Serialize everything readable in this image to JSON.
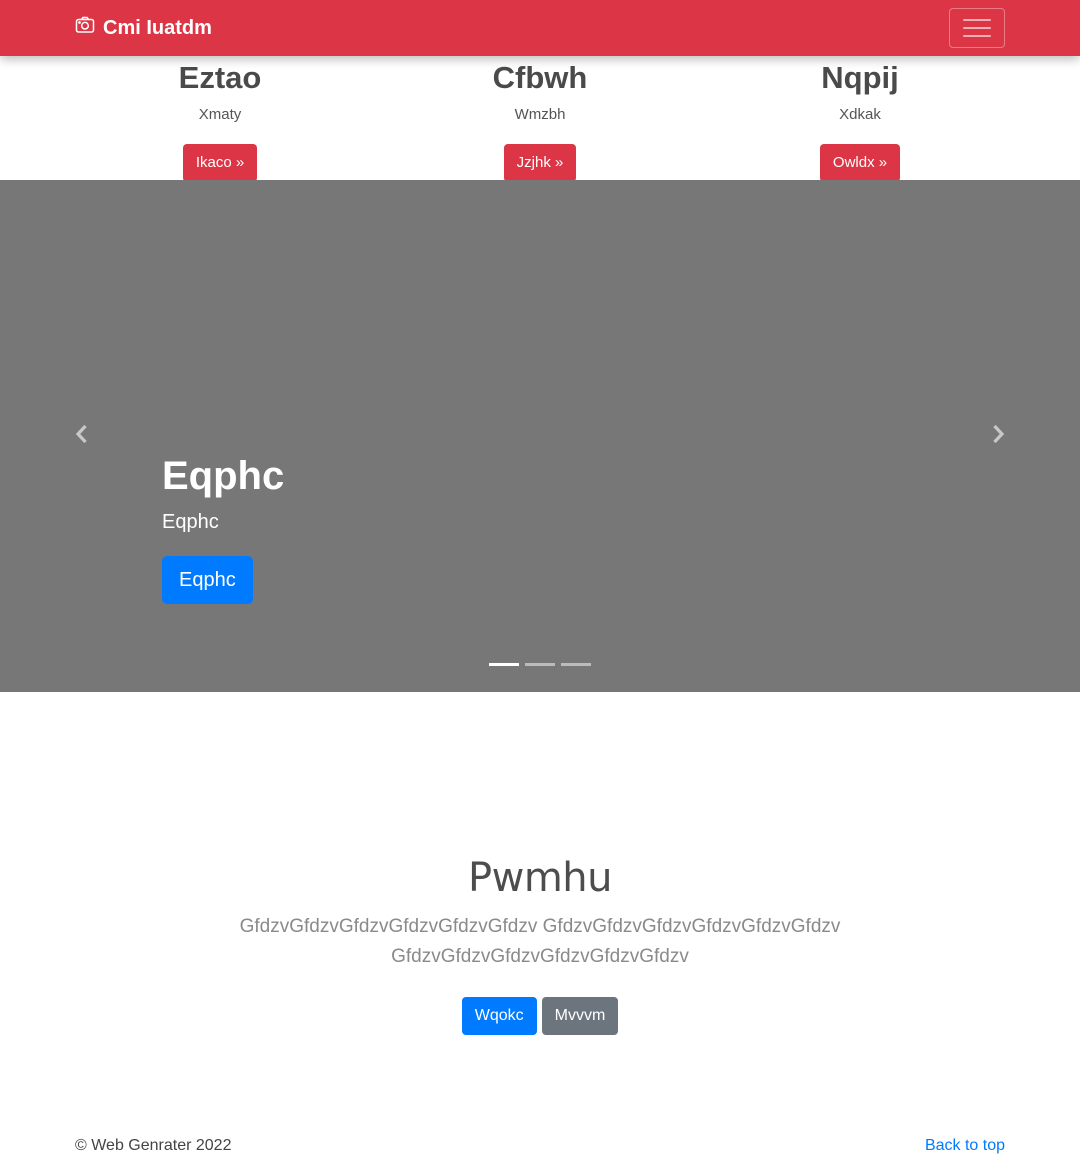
{
  "navbar": {
    "brand_icon": "camera-icon",
    "brand_name": "Cmi Iuatdm",
    "toggler_icon": "hamburger-menu-icon",
    "color": "#dc3545"
  },
  "features": [
    {
      "title": "Eztao",
      "text": "Xmaty",
      "button": "Ikaco »"
    },
    {
      "title": "Cfbwh",
      "text": "Wmzbh",
      "button": "Jzjhk »"
    },
    {
      "title": "Nqpij",
      "text": "Xdkak",
      "button": "Owldx »"
    }
  ],
  "carousel": {
    "background": "#777777",
    "prev_icon": "chevron-left-icon",
    "next_icon": "chevron-right-icon",
    "slide": {
      "title": "Eqphc",
      "subtitle": "Eqphc",
      "button": "Eqphc"
    },
    "indicator_count": 3,
    "active_index": 0
  },
  "jumbotron": {
    "heading": "Pwmhu",
    "lead": "GfdzvGfdzvGfdzvGfdzvGfdzvGfdzv GfdzvGfdzvGfdzvGfdzvGfdzvGfdzv GfdzvGfdzvGfdzvGfdzvGfdzvGfdzv",
    "primary_button": "Wqokc",
    "secondary_button": "Mvvvm"
  },
  "footer": {
    "copyright": "© Web Genrater 2022",
    "back_to_top": "Back to top"
  }
}
